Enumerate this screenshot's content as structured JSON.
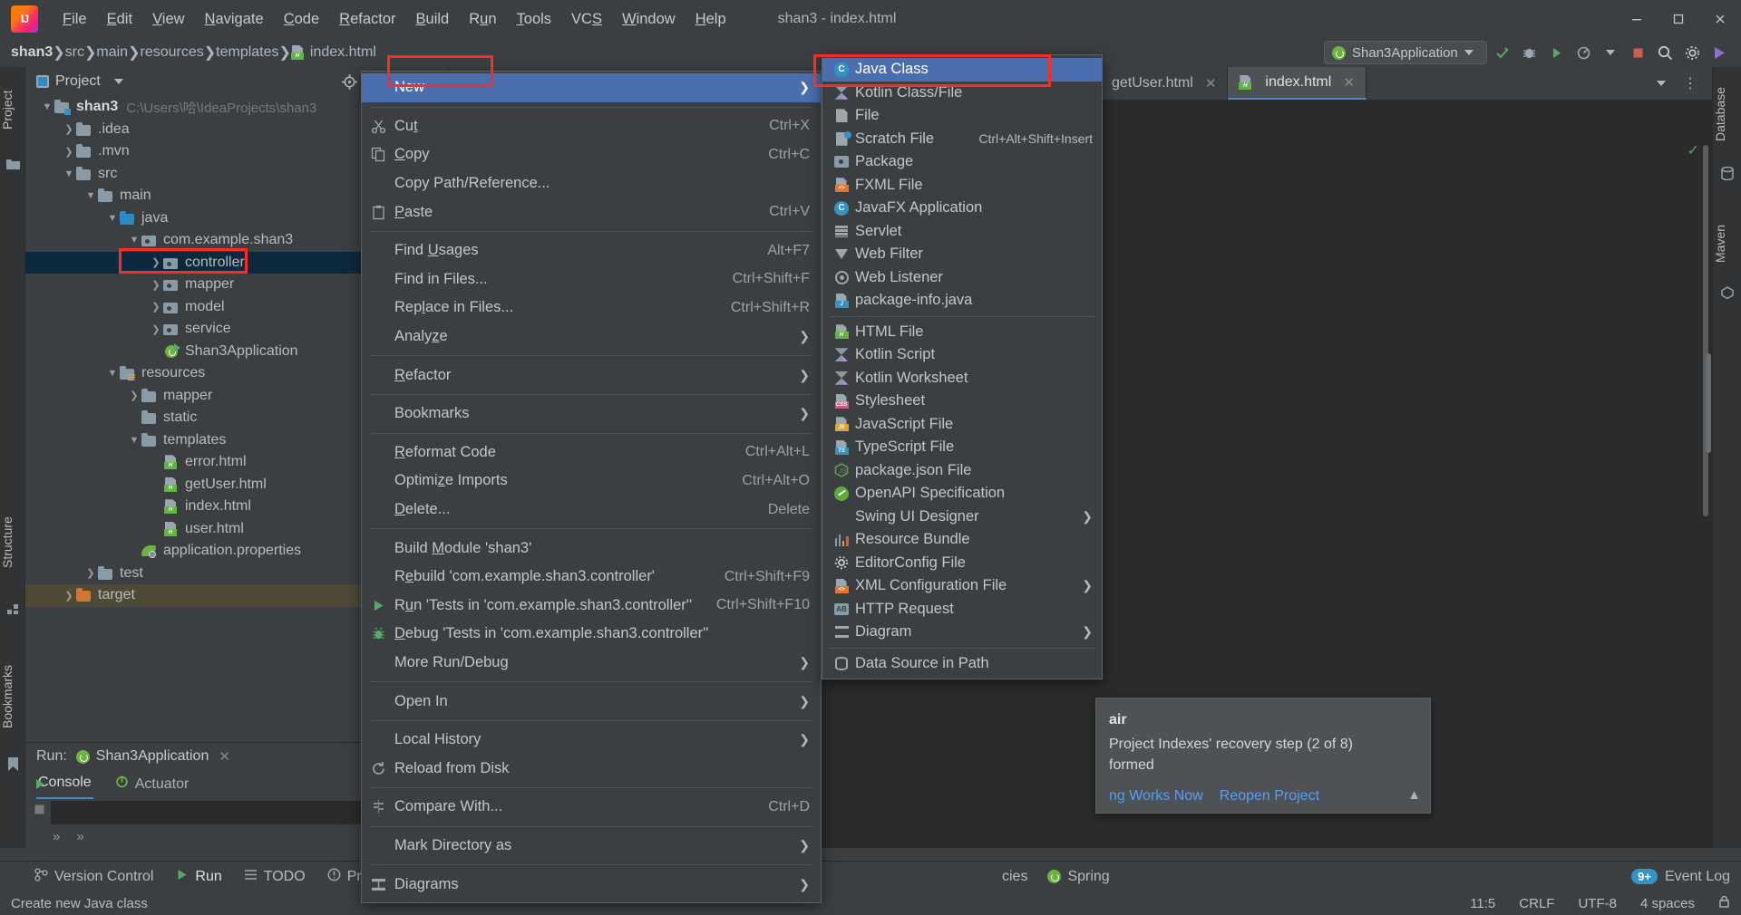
{
  "window": {
    "title": "shan3 - index.html",
    "logo_text": "IJ"
  },
  "menubar": [
    {
      "label": "File"
    },
    {
      "label": "Edit"
    },
    {
      "label": "View"
    },
    {
      "label": "Navigate"
    },
    {
      "label": "Code"
    },
    {
      "label": "Refactor"
    },
    {
      "label": "Build"
    },
    {
      "label": "Run"
    },
    {
      "label": "Tools"
    },
    {
      "label": "VCS"
    },
    {
      "label": "Window"
    },
    {
      "label": "Help"
    }
  ],
  "window_controls": {
    "minimize": "minimize-icon",
    "maximize": "maximize-icon",
    "close": "close-icon"
  },
  "breadcrumb": [
    {
      "label": "shan3",
      "bold": true
    },
    {
      "label": "src",
      "bold": false
    },
    {
      "label": "main",
      "bold": false
    },
    {
      "label": "resources",
      "bold": false
    },
    {
      "label": "templates",
      "bold": false
    },
    {
      "label": "index.html",
      "bold": false,
      "icon": "html-file-icon"
    }
  ],
  "run_toolbar": {
    "config_name": "Shan3Application",
    "icons": [
      "search-icon",
      "settings-icon",
      "updates-icon",
      "run-icon",
      "debug-icon",
      "coverage-icon",
      "profile-icon",
      "stop-icon"
    ]
  },
  "project_panel": {
    "title": "Project",
    "tool_icons": [
      "locate-icon",
      "collapse-all-icon",
      "expand-icon",
      "settings-gear-icon",
      "hide-icon"
    ],
    "tree": [
      {
        "indent": 0,
        "arrow": "down",
        "icon": "module-folder-icon",
        "label": "shan3",
        "bold": true,
        "path": "C:\\Users\\哈\\IdeaProjects\\shan3"
      },
      {
        "indent": 1,
        "arrow": "right",
        "icon": "folder-icon",
        "label": ".idea"
      },
      {
        "indent": 1,
        "arrow": "right",
        "icon": "folder-icon",
        "label": ".mvn"
      },
      {
        "indent": 1,
        "arrow": "down",
        "icon": "folder-icon",
        "label": "src"
      },
      {
        "indent": 2,
        "arrow": "down",
        "icon": "folder-icon",
        "label": "main"
      },
      {
        "indent": 3,
        "arrow": "down",
        "icon": "source-root-icon",
        "label": "java"
      },
      {
        "indent": 4,
        "arrow": "down",
        "icon": "package-icon",
        "label": "com.example.shan3"
      },
      {
        "indent": 5,
        "arrow": "right",
        "icon": "package-icon",
        "label": "controller",
        "selected": true,
        "highlighted": true
      },
      {
        "indent": 5,
        "arrow": "right",
        "icon": "package-icon",
        "label": "mapper"
      },
      {
        "indent": 5,
        "arrow": "right",
        "icon": "package-icon",
        "label": "model"
      },
      {
        "indent": 5,
        "arrow": "right",
        "icon": "package-icon",
        "label": "service"
      },
      {
        "indent": 5,
        "arrow": "none",
        "icon": "spring-boot-app-icon",
        "label": "Shan3Application"
      },
      {
        "indent": 3,
        "arrow": "down",
        "icon": "resources-root-icon",
        "label": "resources"
      },
      {
        "indent": 4,
        "arrow": "right",
        "icon": "folder-icon",
        "label": "mapper"
      },
      {
        "indent": 4,
        "arrow": "none",
        "icon": "folder-icon",
        "label": "static"
      },
      {
        "indent": 4,
        "arrow": "down",
        "icon": "folder-icon",
        "label": "templates"
      },
      {
        "indent": 5,
        "arrow": "none",
        "icon": "html-file-icon",
        "label": "error.html"
      },
      {
        "indent": 5,
        "arrow": "none",
        "icon": "html-file-icon",
        "label": "getUser.html"
      },
      {
        "indent": 5,
        "arrow": "none",
        "icon": "html-file-icon",
        "label": "index.html"
      },
      {
        "indent": 5,
        "arrow": "none",
        "icon": "html-file-icon",
        "label": "user.html"
      },
      {
        "indent": 4,
        "arrow": "none",
        "icon": "properties-file-icon",
        "label": "application.properties"
      },
      {
        "indent": 2,
        "arrow": "right",
        "icon": "folder-icon",
        "label": "test"
      },
      {
        "indent": 1,
        "arrow": "right",
        "icon": "target-folder-icon",
        "label": "target",
        "target_selected": true
      }
    ]
  },
  "context_menu": {
    "items": [
      {
        "label": "New",
        "icon": "",
        "accel": "",
        "submenu": true,
        "highlighted": true,
        "mnemonic": "N"
      },
      {
        "sep": true
      },
      {
        "label": "Cut",
        "icon": "scissors-icon",
        "accel": "Ctrl+X"
      },
      {
        "label": "Copy",
        "icon": "copy-icon",
        "accel": "Ctrl+C"
      },
      {
        "label": "Copy Path/Reference...",
        "icon": "",
        "accel": ""
      },
      {
        "label": "Paste",
        "icon": "clipboard-icon",
        "accel": "Ctrl+V"
      },
      {
        "sep": true
      },
      {
        "label": "Find Usages",
        "icon": "",
        "accel": "Alt+F7"
      },
      {
        "label": "Find in Files...",
        "icon": "",
        "accel": "Ctrl+Shift+F"
      },
      {
        "label": "Replace in Files...",
        "icon": "",
        "accel": "Ctrl+Shift+R"
      },
      {
        "label": "Analyze",
        "icon": "",
        "accel": "",
        "submenu": true
      },
      {
        "sep": true
      },
      {
        "label": "Refactor",
        "icon": "",
        "accel": "",
        "submenu": true
      },
      {
        "sep": true
      },
      {
        "label": "Bookmarks",
        "icon": "",
        "accel": "",
        "submenu": true
      },
      {
        "sep": true
      },
      {
        "label": "Reformat Code",
        "icon": "",
        "accel": "Ctrl+Alt+L"
      },
      {
        "label": "Optimize Imports",
        "icon": "",
        "accel": "Ctrl+Alt+O"
      },
      {
        "label": "Delete...",
        "icon": "",
        "accel": "Delete"
      },
      {
        "sep": true
      },
      {
        "label": "Build Module 'shan3'",
        "icon": "",
        "accel": ""
      },
      {
        "label": "Rebuild 'com.example.shan3.controller'",
        "icon": "",
        "accel": "Ctrl+Shift+F9"
      },
      {
        "label": "Run 'Tests in 'com.example.shan3.controller''",
        "icon": "run-green-icon",
        "accel": "Ctrl+Shift+F10"
      },
      {
        "label": "Debug 'Tests in 'com.example.shan3.controller''",
        "icon": "debug-green-icon",
        "accel": ""
      },
      {
        "label": "More Run/Debug",
        "icon": "",
        "accel": "",
        "submenu": true
      },
      {
        "sep": true
      },
      {
        "label": "Open In",
        "icon": "",
        "accel": "",
        "submenu": true
      },
      {
        "sep": true
      },
      {
        "label": "Local History",
        "icon": "",
        "accel": "",
        "submenu": true
      },
      {
        "label": "Reload from Disk",
        "icon": "refresh-icon",
        "accel": ""
      },
      {
        "sep": true
      },
      {
        "label": "Compare With...",
        "icon": "compare-icon",
        "accel": "Ctrl+D"
      },
      {
        "sep": true
      },
      {
        "label": "Mark Directory as",
        "icon": "",
        "accel": "",
        "submenu": true
      },
      {
        "sep": true
      },
      {
        "label": "Diagrams",
        "icon": "diagram-icon",
        "accel": "",
        "submenu": true
      }
    ]
  },
  "new_submenu": {
    "items": [
      {
        "label": "Java Class",
        "icon": "java-class-icon",
        "highlighted": true
      },
      {
        "label": "Kotlin Class/File",
        "icon": "kotlin-class-icon"
      },
      {
        "label": "File",
        "icon": "file-icon"
      },
      {
        "label": "Scratch File",
        "icon": "scratch-file-icon",
        "accel": "Ctrl+Alt+Shift+Insert"
      },
      {
        "label": "Package",
        "icon": "package-icon"
      },
      {
        "label": "FXML File",
        "icon": "fxml-file-icon"
      },
      {
        "label": "JavaFX Application",
        "icon": "javafx-app-icon"
      },
      {
        "label": "Servlet",
        "icon": "servlet-icon"
      },
      {
        "label": "Web Filter",
        "icon": "web-filter-icon"
      },
      {
        "label": "Web Listener",
        "icon": "web-listener-icon"
      },
      {
        "label": "package-info.java",
        "icon": "package-info-icon"
      },
      {
        "sep": true
      },
      {
        "label": "HTML File",
        "icon": "html-file-icon"
      },
      {
        "label": "Kotlin Script",
        "icon": "kotlin-script-icon"
      },
      {
        "label": "Kotlin Worksheet",
        "icon": "kotlin-worksheet-icon"
      },
      {
        "label": "Stylesheet",
        "icon": "css-file-icon"
      },
      {
        "label": "JavaScript File",
        "icon": "js-file-icon"
      },
      {
        "label": "TypeScript File",
        "icon": "ts-file-icon"
      },
      {
        "label": "package.json File",
        "icon": "node-package-icon"
      },
      {
        "label": "OpenAPI Specification",
        "icon": "openapi-icon"
      },
      {
        "label": "Swing UI Designer",
        "icon": "",
        "submenu": true
      },
      {
        "label": "Resource Bundle",
        "icon": "resource-bundle-icon"
      },
      {
        "label": "EditorConfig File",
        "icon": "editorconfig-icon"
      },
      {
        "label": "XML Configuration File",
        "icon": "xml-config-icon",
        "submenu": true
      },
      {
        "label": "HTTP Request",
        "icon": "http-request-icon"
      },
      {
        "label": "Diagram",
        "icon": "diagram-icon",
        "submenu": true
      },
      {
        "sep": true
      },
      {
        "label": "Data Source in Path",
        "icon": "datasource-icon"
      }
    ]
  },
  "editor_tabs": [
    {
      "label": "getUser.html",
      "icon": "html-file-icon",
      "active": false
    },
    {
      "label": "index.html",
      "icon": "html-file-icon",
      "active": true
    }
  ],
  "editor_tabbar_right": [
    "chevron-down-icon",
    "more-options-icon"
  ],
  "run_panel": {
    "label": "Run:",
    "config_name": "Shan3Application",
    "tabs": [
      {
        "label": "Console",
        "icon": "",
        "active": true
      },
      {
        "label": "Actuator",
        "icon": "actuator-icon",
        "active": false
      }
    ]
  },
  "notification": {
    "title": "air",
    "body_line1": "Project Indexes' recovery step (2 of 8)",
    "body_line2": "formed",
    "link1": "ng Works Now",
    "link2": "Reopen Project"
  },
  "bottom_bar": {
    "items": [
      {
        "label": "Version Control",
        "icon": "version-control-icon"
      },
      {
        "label": "Run",
        "icon": "run-green-icon",
        "active": true
      },
      {
        "label": "TODO",
        "icon": "todo-icon"
      },
      {
        "label": "Proble",
        "icon": "problems-icon"
      }
    ],
    "right_items": [
      {
        "label": "cies",
        "icon": "dependencies-icon"
      },
      {
        "label": "Spring",
        "icon": "spring-icon"
      },
      {
        "label": "Event Log",
        "icon": "event-log-icon",
        "badge": "9+"
      }
    ]
  },
  "status_bar": {
    "message": "Create new Java class",
    "right": [
      "11:5",
      "CRLF",
      "UTF-8",
      "4 spaces"
    ]
  },
  "left_strip_labels": [
    "Project",
    "Structure",
    "Bookmarks"
  ],
  "right_strip_labels": [
    "Database",
    "Maven"
  ],
  "colors": {
    "accent_blue": "#4b6eaf",
    "highlight_red": "#fe2b25",
    "selection_navy": "#0d293e",
    "target_olive": "#4e4a36",
    "panel_bg": "#3c3f41",
    "editor_bg": "#2b2b2b",
    "link_blue": "#589df6",
    "green": "#59a869"
  }
}
